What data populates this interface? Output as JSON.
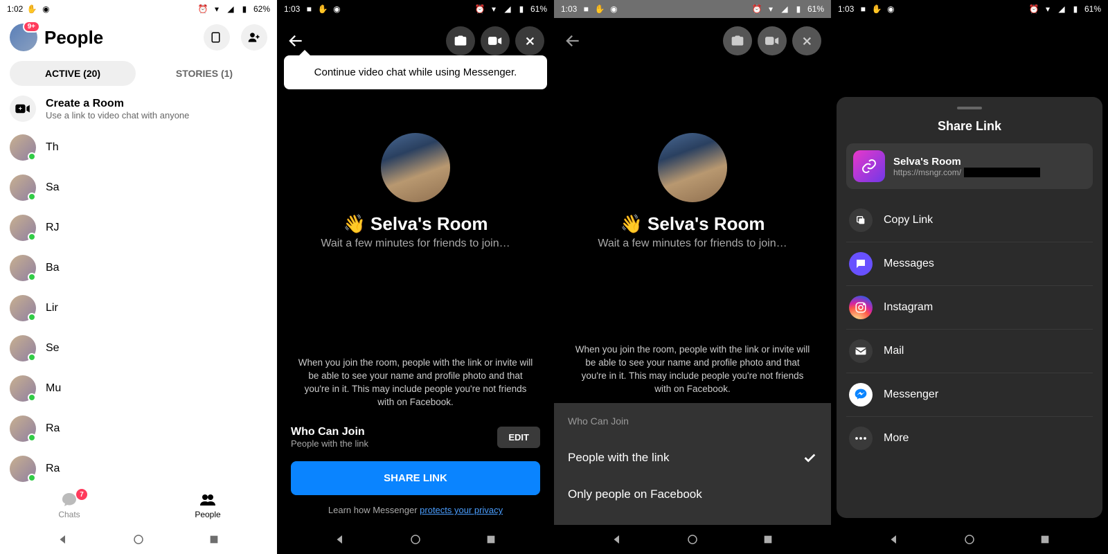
{
  "panes": [
    {
      "statusbar": {
        "time": "1:02",
        "battery": "62%"
      }
    },
    {
      "statusbar": {
        "time": "1:03",
        "battery": "61%"
      }
    },
    {
      "statusbar": {
        "time": "1:03",
        "battery": "61%"
      }
    },
    {
      "statusbar": {
        "time": "1:03",
        "battery": "61%"
      }
    }
  ],
  "people": {
    "title": "People",
    "avatar_badge": "9+",
    "tabs": {
      "active": "ACTIVE (20)",
      "stories": "STORIES (1)"
    },
    "create": {
      "title": "Create a Room",
      "sub": "Use a link to video chat with anyone"
    },
    "contacts": [
      "Th",
      "Sa",
      "RJ",
      "Ba",
      "Lir",
      "Se",
      "Mu",
      "Ra",
      "Ra"
    ],
    "bottom": {
      "chats": "Chats",
      "chats_badge": "7",
      "people": "People"
    }
  },
  "room": {
    "tooltip": "Continue video chat while using Messenger.",
    "name": "👋 Selva's Room",
    "sub": "Wait a few minutes for friends to join…",
    "disclaimer": "When you join the room, people with the link or invite will be able to see your name and profile photo and that you're in it. This may include people you're not friends with on Facebook.",
    "who": {
      "title": "Who Can Join",
      "sub": "People with the link",
      "edit": "EDIT"
    },
    "share": "SHARE LINK",
    "privacy_prefix": "Learn how Messenger ",
    "privacy_link": "protects your privacy"
  },
  "whosheet": {
    "title": "Who Can Join",
    "opt1": "People with the link",
    "opt2": "Only people on Facebook"
  },
  "sharesheet": {
    "title": "Share Link",
    "card": {
      "title": "Selva's Room",
      "url": "https://msngr.com/"
    },
    "opts": {
      "copy": "Copy Link",
      "messages": "Messages",
      "instagram": "Instagram",
      "mail": "Mail",
      "messenger": "Messenger",
      "more": "More"
    }
  }
}
